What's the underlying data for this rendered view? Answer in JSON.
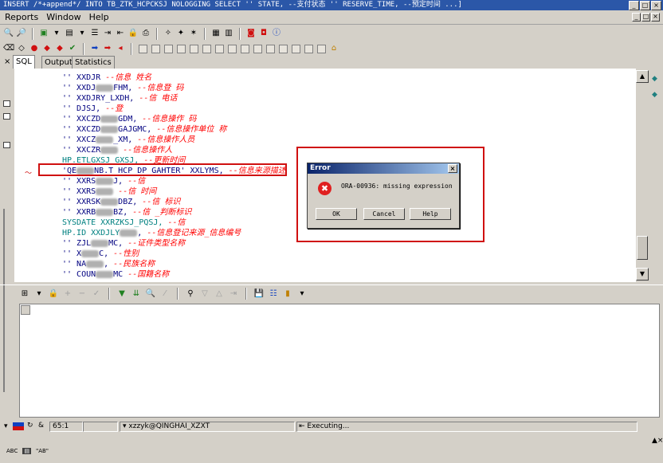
{
  "title_bar": {
    "text": "INSERT /*+append*/ INTO TB_ZTK_HCPCKSJ NOLOGGING SELECT '' STATE, --支付状态 '' RESERVE_TIME, --预定时间 ...]"
  },
  "menu": {
    "items": [
      "Reports",
      "Window",
      "Help"
    ]
  },
  "tabs": [
    "SQL",
    "Output",
    "Statistics"
  ],
  "editor": {
    "lines": [
      {
        "prefix": "'' XXDJR",
        "comment": "--信息          姓名"
      },
      {
        "prefix": "'' XXDJ",
        "mid": "FHM,",
        "comment": "--信息登              码"
      },
      {
        "prefix": "'' XXDJRY_LXDH,",
        "comment": "--信            电话"
      },
      {
        "prefix": "'' DJSJ,",
        "comment": "--登          "
      },
      {
        "prefix": "'' XXCZD",
        "mid": "GDM,",
        "comment": "--信息操作                         码"
      },
      {
        "prefix": "'' XXCZD",
        "mid": "GAJGMC,",
        "comment": "--信息操作单位            称"
      },
      {
        "prefix": "'' XXCZ",
        "mid": "_XM,",
        "comment": "--信息操作人员       "
      },
      {
        "prefix": "'' XXCZR",
        "mid": "",
        "comment": "--信息操作人         "
      },
      {
        "prefix": "HP.ETLGXSJ GXSJ,",
        "comment": "--更新时间"
      },
      {
        "prefix": "'QE",
        "mid": "NB.T_HCP_DP_GAHTER' XXLYMS,",
        "comment": "--信息来源描述"
      },
      {
        "prefix": "'' XXRS",
        "mid": "J,",
        "comment": "--信       "
      },
      {
        "prefix": "'' XXRS",
        "mid": "",
        "comment": "--信       时间"
      },
      {
        "prefix": "'' XXRSK",
        "mid": "DBZ,",
        "comment": "--信           标识"
      },
      {
        "prefix": "'' XXRB",
        "mid": "BZ,",
        "comment": "--信       _判断标识"
      },
      {
        "prefix": "SYSDATE XXRZKSJ_PQSJ,",
        "comment": "--信"
      },
      {
        "prefix": "HP.ID XXDJLY",
        "mid": ",",
        "comment": "--信息登记来源_信息编号"
      },
      {
        "prefix": "'' ZJL",
        "mid": "MC,",
        "comment": "--证件类型名称"
      },
      {
        "prefix": "'' X",
        "mid": "C,",
        "comment": "--性别"
      },
      {
        "prefix": "'' NA",
        "mid": ",",
        "comment": "--民族名称"
      },
      {
        "prefix": "'' COUN",
        "mid": "MC",
        "comment": "--国籍名称"
      }
    ]
  },
  "dialog": {
    "title": "Error",
    "message": "ORA-00936: missing expression",
    "ok_label": "OK",
    "cancel_label": "Cancel",
    "help_label": "Help"
  },
  "status": {
    "position": "65:1",
    "connection": "xzzyk@QINGHAI_XZXT",
    "state": "Executing..."
  },
  "ime": {
    "labels": [
      "ABC",
      "\"AB\""
    ]
  },
  "colors": {
    "accent_red": "#d01010",
    "keyword": "#008080",
    "comment": "#ff0000",
    "code": "#000080"
  }
}
